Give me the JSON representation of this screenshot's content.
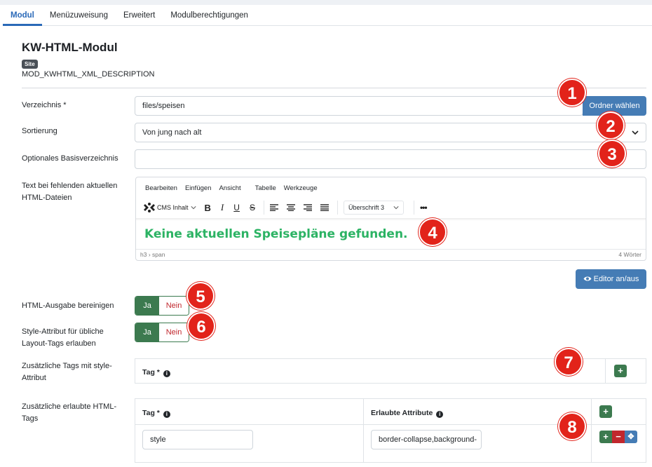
{
  "tabs": [
    "Modul",
    "Menüzuweisung",
    "Erweitert",
    "Modulberechtigungen"
  ],
  "module": {
    "title": "KW-HTML-Modul",
    "badge": "Site",
    "description": "MOD_KWHTML_XML_DESCRIPTION"
  },
  "fields": {
    "verzeichnis": {
      "label": "Verzeichnis *",
      "value": "files/speisen",
      "button": "Ordner wählen"
    },
    "sortierung": {
      "label": "Sortierung",
      "value": "Von jung nach alt"
    },
    "basis": {
      "label": "Optionales Basisverzeichnis",
      "value": ""
    },
    "fehlend": {
      "label_line1": "Text bei fehlenden aktuellen",
      "label_line2": "HTML-Dateien"
    }
  },
  "editor": {
    "menu": [
      "Bearbeiten",
      "Einfügen",
      "Ansicht",
      "Tabelle",
      "Werkzeuge"
    ],
    "cms_label": "CMS Inhalt",
    "format": "Überschrift 3",
    "content": "Keine aktuellen Speisepläne gefunden.",
    "path": "h3 › span",
    "wordcount": "4 Wörter",
    "toggle_button": "Editor an/aus"
  },
  "bereinigen": {
    "label": "HTML-Ausgabe bereinigen",
    "yes": "Ja",
    "no": "Nein"
  },
  "style_attr": {
    "label_line1": "Style-Attribut für übliche",
    "label_line2": "Layout-Tags erlauben",
    "yes": "Ja",
    "no": "Nein"
  },
  "zus_style": {
    "label_line1": "Zusätzliche Tags mit style-",
    "label_line2": "Attribut",
    "col_tag": "Tag *"
  },
  "zus_html": {
    "label_line1": "Zusätzliche erlaubte HTML-",
    "label_line2": "Tags",
    "col_tag": "Tag *",
    "col_attr": "Erlaubte Attribute",
    "row_tag": "style",
    "row_attr": "border-collapse,background-"
  },
  "markers": [
    "1",
    "2",
    "3",
    "4",
    "5",
    "6",
    "7",
    "8"
  ],
  "colors": {
    "accent": "#2a69b8",
    "green": "#3c7a4f",
    "red": "#c1272d",
    "marker": "#e2231a",
    "editor_text": "#2cb364"
  }
}
